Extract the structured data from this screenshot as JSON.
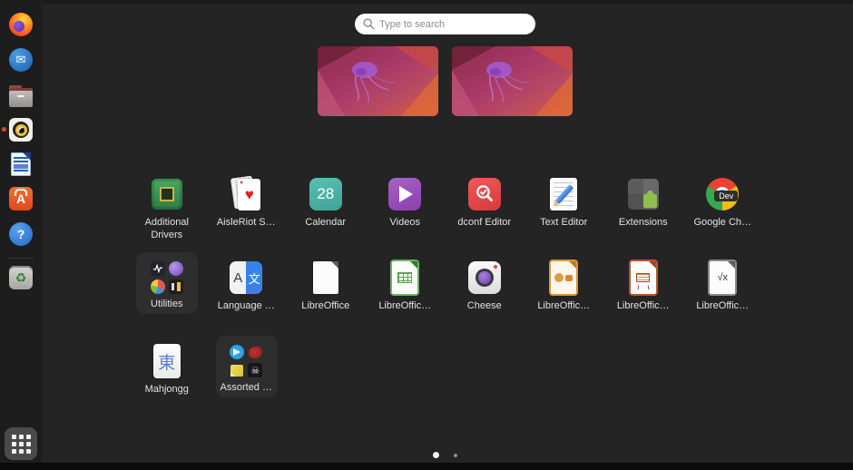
{
  "search": {
    "placeholder": "Type to search"
  },
  "dock": {
    "items": [
      {
        "name": "firefox"
      },
      {
        "name": "thunderbird",
        "glyph": "✉"
      },
      {
        "name": "files"
      },
      {
        "name": "rhythmbox",
        "notification": true
      },
      {
        "name": "libreoffice-writer"
      },
      {
        "name": "ubuntu-software",
        "glyph": "A"
      },
      {
        "name": "help",
        "glyph": "?"
      },
      {
        "name": "trash",
        "glyph": "♻"
      }
    ],
    "show_apps": {
      "name": "show-applications"
    }
  },
  "workspaces": {
    "count": 2
  },
  "apps": [
    {
      "label": "Additional Drivers",
      "icon": "chip-icon"
    },
    {
      "label": "AisleRiot S…",
      "icon": "playing-cards-icon",
      "suit": "♥"
    },
    {
      "label": "Calendar",
      "icon": "calendar-icon",
      "glyph": "28"
    },
    {
      "label": "Videos",
      "icon": "play-icon"
    },
    {
      "label": "dconf Editor",
      "icon": "magnifier-check-icon"
    },
    {
      "label": "Text Editor",
      "icon": "paper-pencil-icon"
    },
    {
      "label": "Extensions",
      "icon": "puzzle-icon"
    },
    {
      "label": "Google Ch…",
      "icon": "chrome-icon",
      "badge": "Dev"
    },
    {
      "label": "Utilities",
      "icon": "folder",
      "minis": [
        "logs",
        "sphere",
        "pie-chart",
        "characters"
      ]
    },
    {
      "label": "Language …",
      "icon": "translate-icon",
      "glyph_a": "A",
      "glyph_b": "文"
    },
    {
      "label": "LibreOffice",
      "icon": "document-icon"
    },
    {
      "label": "LibreOffic…",
      "icon": "spreadsheet-icon"
    },
    {
      "label": "Cheese",
      "icon": "camera-icon"
    },
    {
      "label": "LibreOffic…",
      "icon": "presenter-icon"
    },
    {
      "label": "LibreOffic…",
      "icon": "easel-icon"
    },
    {
      "label": "LibreOffic…",
      "icon": "formula-icon",
      "glyph": "√x"
    },
    {
      "label": "Mahjongg",
      "icon": "tile-icon",
      "glyph": "東"
    },
    {
      "label": "Assorted …",
      "icon": "folder",
      "minis": [
        "telegram",
        "dragon",
        "sticky-note",
        "skull"
      ],
      "skull_glyph": "☠"
    }
  ],
  "pagination": {
    "total": 2,
    "active_index": 0
  },
  "colors": {
    "background": "#242424",
    "dock": "#1d1d1d",
    "folder_bg": "#2e2e2e",
    "label_text": "#e2e2e2",
    "accent_orange": "#e95420"
  }
}
